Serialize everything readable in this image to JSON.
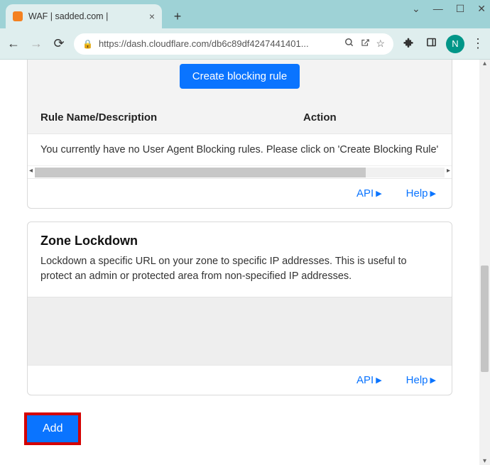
{
  "browser": {
    "tab_title": "WAF | sadded.com |",
    "url_display": "https://dash.cloudflare.com/db6c89df4247441401...",
    "avatar_letter": "N"
  },
  "ua_block": {
    "create_btn": "Create blocking rule",
    "col_rule": "Rule Name/Description",
    "col_action": "Action",
    "empty_msg": "You currently have no User Agent Blocking rules. Please click on 'Create Blocking Rule'",
    "api_label": "API",
    "help_label": "Help"
  },
  "zone": {
    "title": "Zone Lockdown",
    "desc": "Lockdown a specific URL on your zone to specific IP addresses. This is useful to protect an admin or protected area from non-specified IP addresses.",
    "api_label": "API",
    "help_label": "Help"
  },
  "add_btn": "Add"
}
